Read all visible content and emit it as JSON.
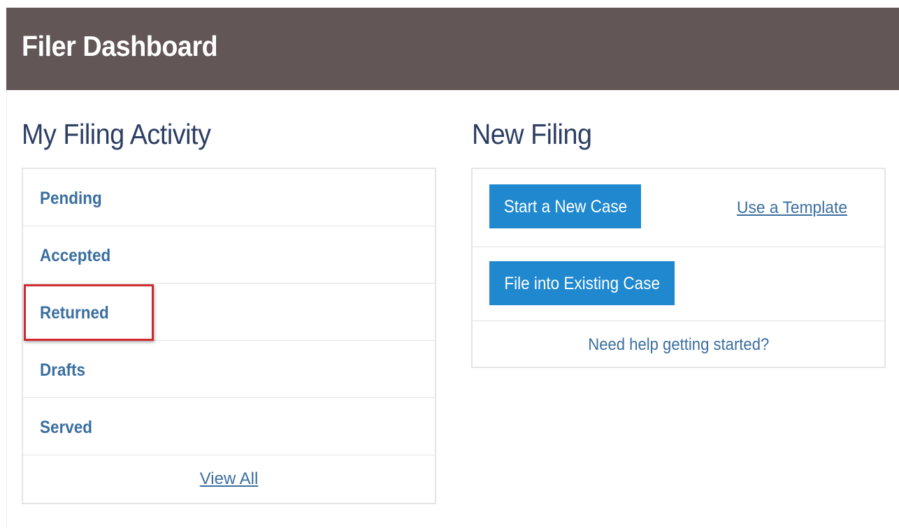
{
  "header": {
    "title": "Filer Dashboard"
  },
  "activity": {
    "title": "My Filing Activity",
    "items": [
      {
        "label": "Pending"
      },
      {
        "label": "Accepted"
      },
      {
        "label": "Returned"
      },
      {
        "label": "Drafts"
      },
      {
        "label": "Served"
      }
    ],
    "view_all_label": "View All",
    "highlighted_item": "Returned"
  },
  "new_filing": {
    "title": "New Filing",
    "start_new_case_label": "Start a New Case",
    "use_template_label": "Use a Template",
    "file_existing_label": "File into Existing Case",
    "help_label": "Need help getting started?"
  },
  "colors": {
    "header_bg": "#635656",
    "button_bg": "#1f88cf",
    "link": "#3b6fa0",
    "heading": "#2c3e63",
    "highlight": "#d0282c"
  }
}
